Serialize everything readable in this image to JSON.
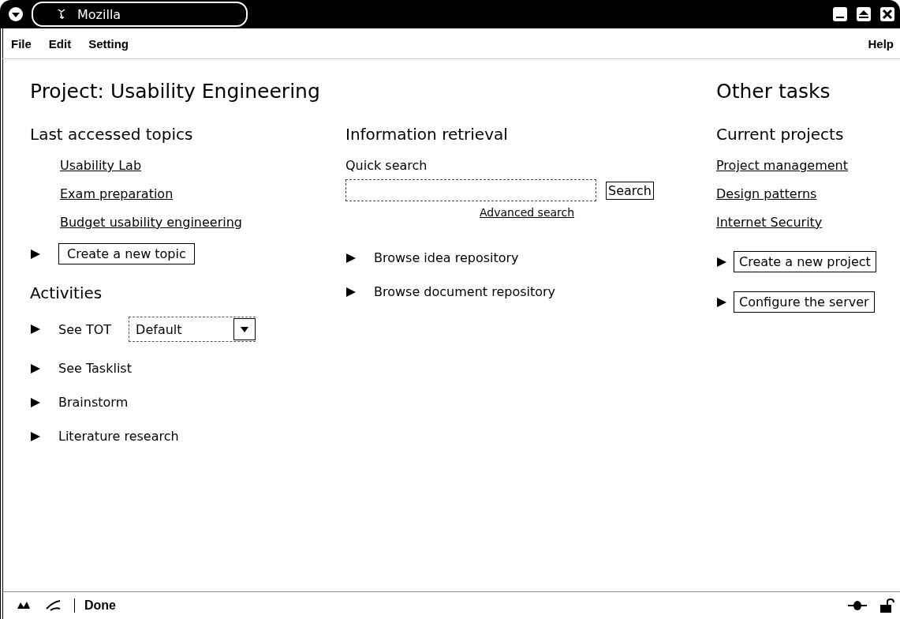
{
  "window": {
    "title": "Mozilla"
  },
  "menu": {
    "items": [
      "File",
      "Edit",
      "Setting"
    ],
    "help": "Help"
  },
  "project_title": "Project: Usability Engineering",
  "other_title": "Other tasks",
  "last_accessed": {
    "heading": "Last accessed topics",
    "links": [
      "Usability Lab",
      "Exam preparation",
      "Budget usability engineering"
    ],
    "button": "Create a new topic"
  },
  "activities": {
    "heading": "Activities",
    "items": [
      {
        "kind": "select",
        "label": "See TOT",
        "value": "Default"
      },
      {
        "kind": "plain",
        "label": "See Tasklist"
      },
      {
        "kind": "plain",
        "label": "Brainstorm"
      },
      {
        "kind": "plain",
        "label": "Literature research"
      }
    ]
  },
  "information": {
    "heading": "Information retrieval",
    "search_label": "Quick search",
    "search_button": "Search",
    "advanced_link": "Advanced search",
    "items": [
      "Browse idea repository",
      "Browse document repository"
    ]
  },
  "current_projects": {
    "heading": "Current projects",
    "links": [
      "Project management",
      "Design patterns",
      "Internet Security"
    ],
    "buttons": [
      "Create a new project",
      "Configure the server"
    ]
  },
  "status_bar": {
    "text": "Done"
  }
}
